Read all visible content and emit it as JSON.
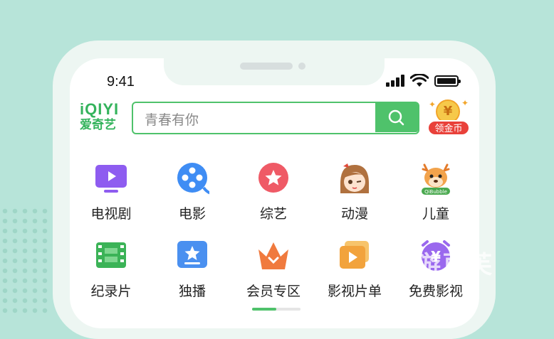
{
  "status_bar": {
    "time": "9:41"
  },
  "header": {
    "logo_top": "iQIYI",
    "logo_bottom": "爱奇艺",
    "search_placeholder": "青春有你",
    "coin_symbol": "¥",
    "coin_label": "领金币"
  },
  "categories": [
    {
      "label": "电视剧",
      "icon": "tv-series-icon"
    },
    {
      "label": "电影",
      "icon": "movie-reel-icon"
    },
    {
      "label": "综艺",
      "icon": "variety-star-icon"
    },
    {
      "label": "动漫",
      "icon": "anime-girl-icon"
    },
    {
      "label": "儿童",
      "icon": "qibubble-deer-icon",
      "icon_text": "QiBubble"
    },
    {
      "label": "纪录片",
      "icon": "documentary-film-icon"
    },
    {
      "label": "独播",
      "icon": "exclusive-star-icon"
    },
    {
      "label": "会员专区",
      "icon": "vip-crown-icon"
    },
    {
      "label": "影视片单",
      "icon": "playlist-icon"
    },
    {
      "label": "免费影视",
      "icon": "free-clock-icon",
      "icon_text": "¥"
    }
  ],
  "watermark": "游豆芙",
  "colors": {
    "brand_green": "#34b35c",
    "search_green": "#4fc26b",
    "background": "#b7e4d9"
  }
}
